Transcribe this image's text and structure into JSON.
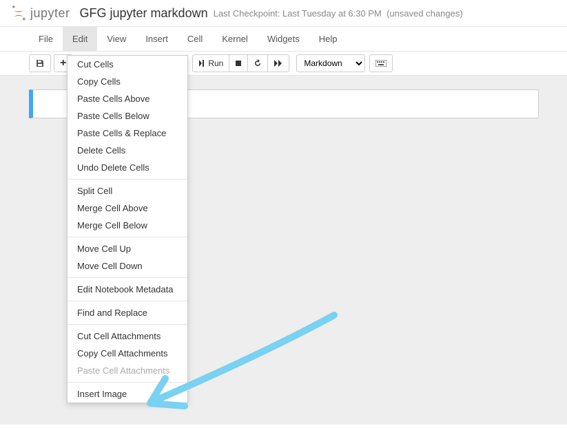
{
  "header": {
    "logo_text": "jupyter",
    "notebook_title": "GFG jupyter markdown",
    "checkpoint": "Last Checkpoint: Last Tuesday at 6:30 PM",
    "unsaved": "(unsaved changes)"
  },
  "menubar": {
    "items": [
      "File",
      "Edit",
      "View",
      "Insert",
      "Cell",
      "Kernel",
      "Widgets",
      "Help"
    ],
    "active_index": 1
  },
  "toolbar": {
    "run_label": "Run",
    "celltype": "Markdown"
  },
  "edit_dropdown": {
    "groups": [
      [
        "Cut Cells",
        "Copy Cells",
        "Paste Cells Above",
        "Paste Cells Below",
        "Paste Cells & Replace",
        "Delete Cells",
        "Undo Delete Cells"
      ],
      [
        "Split Cell",
        "Merge Cell Above",
        "Merge Cell Below"
      ],
      [
        "Move Cell Up",
        "Move Cell Down"
      ],
      [
        "Edit Notebook Metadata"
      ],
      [
        "Find and Replace"
      ],
      [
        "Cut Cell Attachments",
        "Copy Cell Attachments",
        "Paste Cell Attachments"
      ],
      [
        "Insert Image"
      ]
    ],
    "disabled": [
      "Paste Cell Attachments"
    ]
  }
}
